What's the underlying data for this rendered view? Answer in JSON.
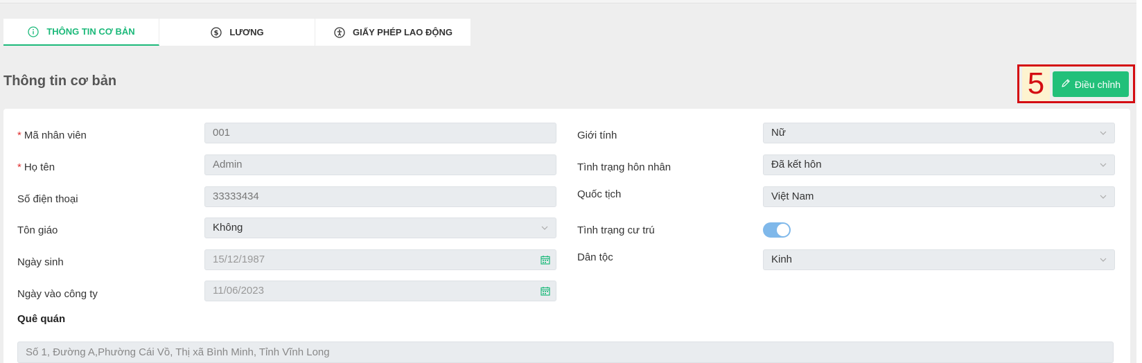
{
  "tabs": [
    {
      "label": "THÔNG TIN CƠ BẢN",
      "icon": "info-circle-icon",
      "active": true
    },
    {
      "label": "LƯƠNG",
      "icon": "dollar-circle-icon",
      "active": false
    },
    {
      "label": "GIẤY PHÉP LAO ĐỘNG",
      "icon": "accessibility-icon",
      "active": false
    }
  ],
  "section_title": "Thông tin cơ bản",
  "step_marker": "5",
  "edit_button": {
    "label": "Điều chỉnh",
    "icon": "pencil-icon"
  },
  "form": {
    "employee_code": {
      "label": "Mã nhân viên",
      "required": "*",
      "value": "001"
    },
    "full_name": {
      "label": "Họ tên",
      "required": "*",
      "value": "Admin"
    },
    "phone": {
      "label": "Số điện thoại",
      "value": "33333434"
    },
    "religion": {
      "label": "Tôn giáo",
      "value": "Không"
    },
    "birth_date": {
      "label": "Ngày sinh",
      "value": "15/12/1987"
    },
    "join_date": {
      "label": "Ngày vào công ty",
      "value": "11/06/2023"
    },
    "gender": {
      "label": "Giới tính",
      "value": "Nữ"
    },
    "marital_status": {
      "label": "Tình trạng hôn nhân",
      "value": "Đã kết hôn"
    },
    "nationality": {
      "label": "Quốc tịch",
      "value": "Việt Nam"
    },
    "residence_status": {
      "label": "Tình trạng cư trú",
      "enabled": true
    },
    "ethnicity": {
      "label": "Dân tộc",
      "value": "Kinh"
    },
    "hometown": {
      "label": "Quê quán",
      "value": "Số 1, Đường A,Phường Cái Vồ, Thị xã Bình Minh, Tỉnh Vĩnh Long"
    }
  },
  "colors": {
    "accent": "#22c07a",
    "required": "#e03131",
    "marker": "#d40d12",
    "toggle": "#7fb8ea"
  }
}
